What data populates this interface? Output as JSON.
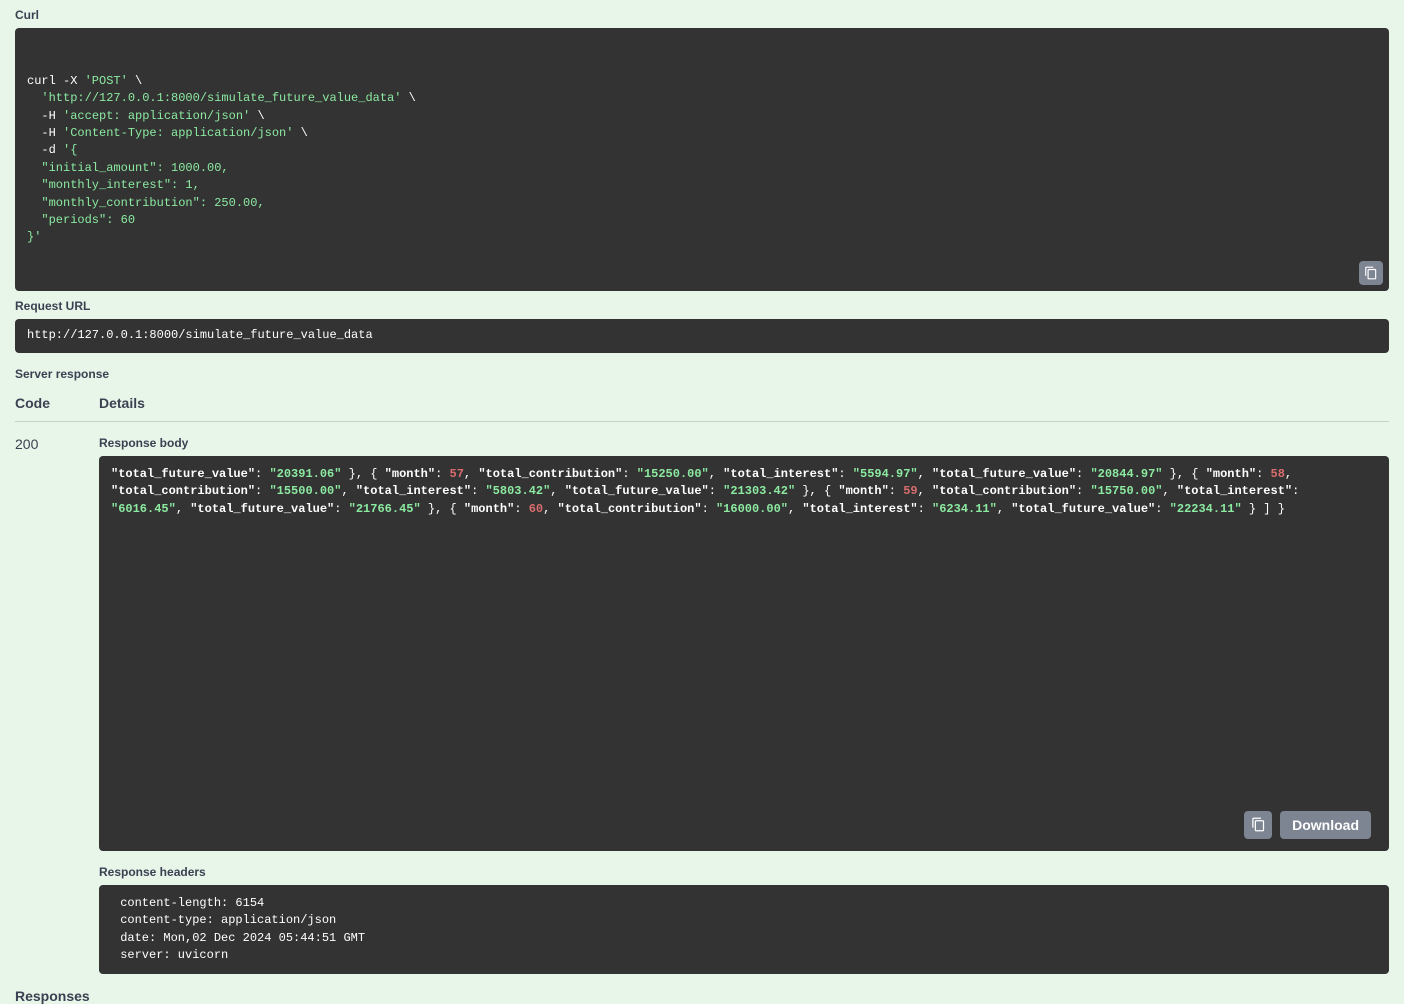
{
  "curl_label": "Curl",
  "curl_lines": [
    [
      {
        "t": "curl -X ",
        "c": "w"
      },
      {
        "t": "'POST'",
        "c": "s"
      },
      {
        "t": " \\",
        "c": "w"
      }
    ],
    [
      {
        "t": "  ",
        "c": "w"
      },
      {
        "t": "'http://127.0.0.1:8000/simulate_future_value_data'",
        "c": "s"
      },
      {
        "t": " \\",
        "c": "w"
      }
    ],
    [
      {
        "t": "  -H ",
        "c": "w"
      },
      {
        "t": "'accept: application/json'",
        "c": "s"
      },
      {
        "t": " \\",
        "c": "w"
      }
    ],
    [
      {
        "t": "  -H ",
        "c": "w"
      },
      {
        "t": "'Content-Type: application/json'",
        "c": "s"
      },
      {
        "t": " \\",
        "c": "w"
      }
    ],
    [
      {
        "t": "  -d ",
        "c": "w"
      },
      {
        "t": "'{",
        "c": "s"
      }
    ],
    [
      {
        "t": "  \"initial_amount\": 1000.00,",
        "c": "s"
      }
    ],
    [
      {
        "t": "  \"monthly_interest\": 1,",
        "c": "s"
      }
    ],
    [
      {
        "t": "  \"monthly_contribution\": 250.00,",
        "c": "s"
      }
    ],
    [
      {
        "t": "  \"periods\": 60",
        "c": "s"
      }
    ],
    [
      {
        "t": "}'",
        "c": "s"
      }
    ]
  ],
  "request_url_label": "Request URL",
  "request_url": "http://127.0.0.1:8000/simulate_future_value_data",
  "server_response_label": "Server response",
  "th_code": "Code",
  "th_details": "Details",
  "status_code": "200",
  "response_body_label": "Response body",
  "response_body_lines": [
    [
      {
        "t": "      ",
        "c": "w"
      },
      {
        "t": "\"total_future_value\"",
        "c": "k"
      },
      {
        "t": ": ",
        "c": "w"
      },
      {
        "t": "\"20391.06\"",
        "c": "sb"
      }
    ],
    [
      {
        "t": "    },",
        "c": "w"
      }
    ],
    [
      {
        "t": "    {",
        "c": "w"
      }
    ],
    [
      {
        "t": "      ",
        "c": "w"
      },
      {
        "t": "\"month\"",
        "c": "k"
      },
      {
        "t": ": ",
        "c": "w"
      },
      {
        "t": "57",
        "c": "n"
      },
      {
        "t": ",",
        "c": "w"
      }
    ],
    [
      {
        "t": "      ",
        "c": "w"
      },
      {
        "t": "\"total_contribution\"",
        "c": "k"
      },
      {
        "t": ": ",
        "c": "w"
      },
      {
        "t": "\"15250.00\"",
        "c": "sb"
      },
      {
        "t": ",",
        "c": "w"
      }
    ],
    [
      {
        "t": "      ",
        "c": "w"
      },
      {
        "t": "\"total_interest\"",
        "c": "k"
      },
      {
        "t": ": ",
        "c": "w"
      },
      {
        "t": "\"5594.97\"",
        "c": "sb"
      },
      {
        "t": ",",
        "c": "w"
      }
    ],
    [
      {
        "t": "      ",
        "c": "w"
      },
      {
        "t": "\"total_future_value\"",
        "c": "k"
      },
      {
        "t": ": ",
        "c": "w"
      },
      {
        "t": "\"20844.97\"",
        "c": "sb"
      }
    ],
    [
      {
        "t": "    },",
        "c": "w"
      }
    ],
    [
      {
        "t": "    {",
        "c": "w"
      }
    ],
    [
      {
        "t": "      ",
        "c": "w"
      },
      {
        "t": "\"month\"",
        "c": "k"
      },
      {
        "t": ": ",
        "c": "w"
      },
      {
        "t": "58",
        "c": "n"
      },
      {
        "t": ",",
        "c": "w"
      }
    ],
    [
      {
        "t": "      ",
        "c": "w"
      },
      {
        "t": "\"total_contribution\"",
        "c": "k"
      },
      {
        "t": ": ",
        "c": "w"
      },
      {
        "t": "\"15500.00\"",
        "c": "sb"
      },
      {
        "t": ",",
        "c": "w"
      }
    ],
    [
      {
        "t": "      ",
        "c": "w"
      },
      {
        "t": "\"total_interest\"",
        "c": "k"
      },
      {
        "t": ": ",
        "c": "w"
      },
      {
        "t": "\"5803.42\"",
        "c": "sb"
      },
      {
        "t": ",",
        "c": "w"
      }
    ],
    [
      {
        "t": "      ",
        "c": "w"
      },
      {
        "t": "\"total_future_value\"",
        "c": "k"
      },
      {
        "t": ": ",
        "c": "w"
      },
      {
        "t": "\"21303.42\"",
        "c": "sb"
      }
    ],
    [
      {
        "t": "    },",
        "c": "w"
      }
    ],
    [
      {
        "t": "    {",
        "c": "w"
      }
    ],
    [
      {
        "t": "      ",
        "c": "w"
      },
      {
        "t": "\"month\"",
        "c": "k"
      },
      {
        "t": ": ",
        "c": "w"
      },
      {
        "t": "59",
        "c": "n"
      },
      {
        "t": ",",
        "c": "w"
      }
    ],
    [
      {
        "t": "      ",
        "c": "w"
      },
      {
        "t": "\"total_contribution\"",
        "c": "k"
      },
      {
        "t": ": ",
        "c": "w"
      },
      {
        "t": "\"15750.00\"",
        "c": "sb"
      },
      {
        "t": ",",
        "c": "w"
      }
    ],
    [
      {
        "t": "      ",
        "c": "w"
      },
      {
        "t": "\"total_interest\"",
        "c": "k"
      },
      {
        "t": ": ",
        "c": "w"
      },
      {
        "t": "\"6016.45\"",
        "c": "sb"
      },
      {
        "t": ",",
        "c": "w"
      }
    ],
    [
      {
        "t": "      ",
        "c": "w"
      },
      {
        "t": "\"total_future_value\"",
        "c": "k"
      },
      {
        "t": ": ",
        "c": "w"
      },
      {
        "t": "\"21766.45\"",
        "c": "sb"
      }
    ],
    [
      {
        "t": "    },",
        "c": "w"
      }
    ],
    [
      {
        "t": "    {",
        "c": "w"
      }
    ],
    [
      {
        "t": "      ",
        "c": "w"
      },
      {
        "t": "\"month\"",
        "c": "k"
      },
      {
        "t": ": ",
        "c": "w"
      },
      {
        "t": "60",
        "c": "n"
      },
      {
        "t": ",",
        "c": "w"
      }
    ],
    [
      {
        "t": "      ",
        "c": "w"
      },
      {
        "t": "\"total_contribution\"",
        "c": "k"
      },
      {
        "t": ": ",
        "c": "w"
      },
      {
        "t": "\"16000.00\"",
        "c": "sb"
      },
      {
        "t": ",",
        "c": "w"
      }
    ],
    [
      {
        "t": "      ",
        "c": "w"
      },
      {
        "t": "\"total_interest\"",
        "c": "k"
      },
      {
        "t": ": ",
        "c": "w"
      },
      {
        "t": "\"6234.11\"",
        "c": "sb"
      },
      {
        "t": ",",
        "c": "w"
      }
    ],
    [
      {
        "t": "      ",
        "c": "w"
      },
      {
        "t": "\"total_future_value\"",
        "c": "k"
      },
      {
        "t": ": ",
        "c": "w"
      },
      {
        "t": "\"22234.11\"",
        "c": "sb"
      }
    ],
    [
      {
        "t": "    }",
        "c": "w"
      }
    ],
    [
      {
        "t": "  ]",
        "c": "w"
      }
    ],
    [
      {
        "t": "}",
        "c": "w"
      }
    ]
  ],
  "download_label": "Download",
  "response_headers_label": "Response headers",
  "response_headers_lines": [
    " content-length: 6154 ",
    " content-type: application/json ",
    " date: Mon,02 Dec 2024 05:44:51 GMT ",
    " server: uvicorn "
  ],
  "responses_label": "Responses"
}
